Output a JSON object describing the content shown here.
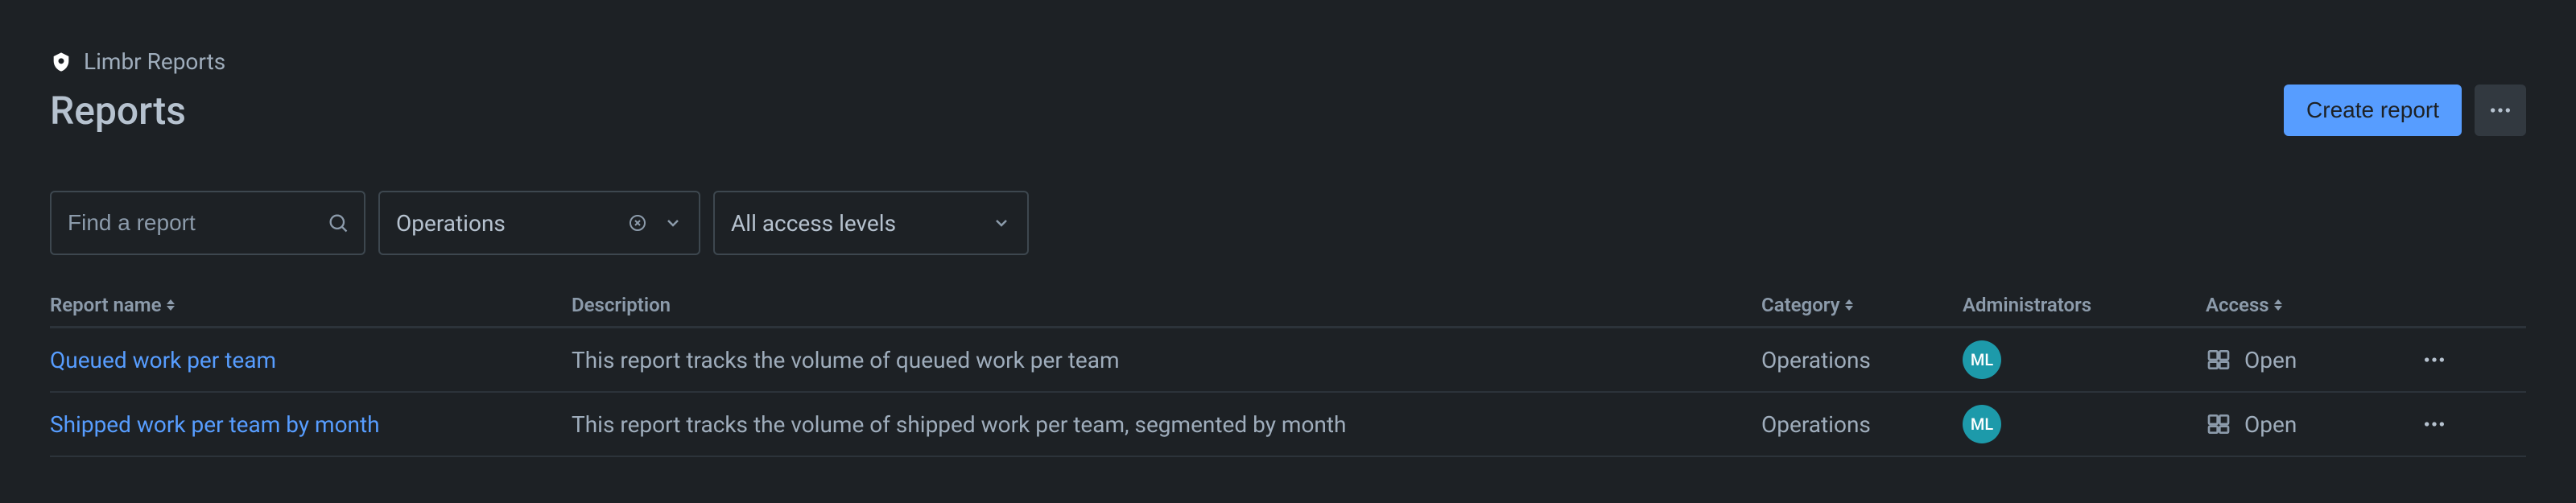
{
  "breadcrumb": {
    "app_name": "Limbr Reports"
  },
  "header": {
    "title": "Reports",
    "create_button": "Create report"
  },
  "filters": {
    "search_placeholder": "Find a report",
    "category_value": "Operations",
    "access_value": "All access levels"
  },
  "table": {
    "columns": {
      "name": "Report name",
      "description": "Description",
      "category": "Category",
      "administrators": "Administrators",
      "access": "Access"
    },
    "rows": [
      {
        "name": "Queued work per team",
        "description": "This report tracks the volume of queued work per team",
        "category": "Operations",
        "admin_initials": "ML",
        "access": "Open"
      },
      {
        "name": "Shipped work per team by month",
        "description": "This report tracks the volume of shipped work per team, segmented by month",
        "category": "Operations",
        "admin_initials": "ML",
        "access": "Open"
      }
    ]
  }
}
